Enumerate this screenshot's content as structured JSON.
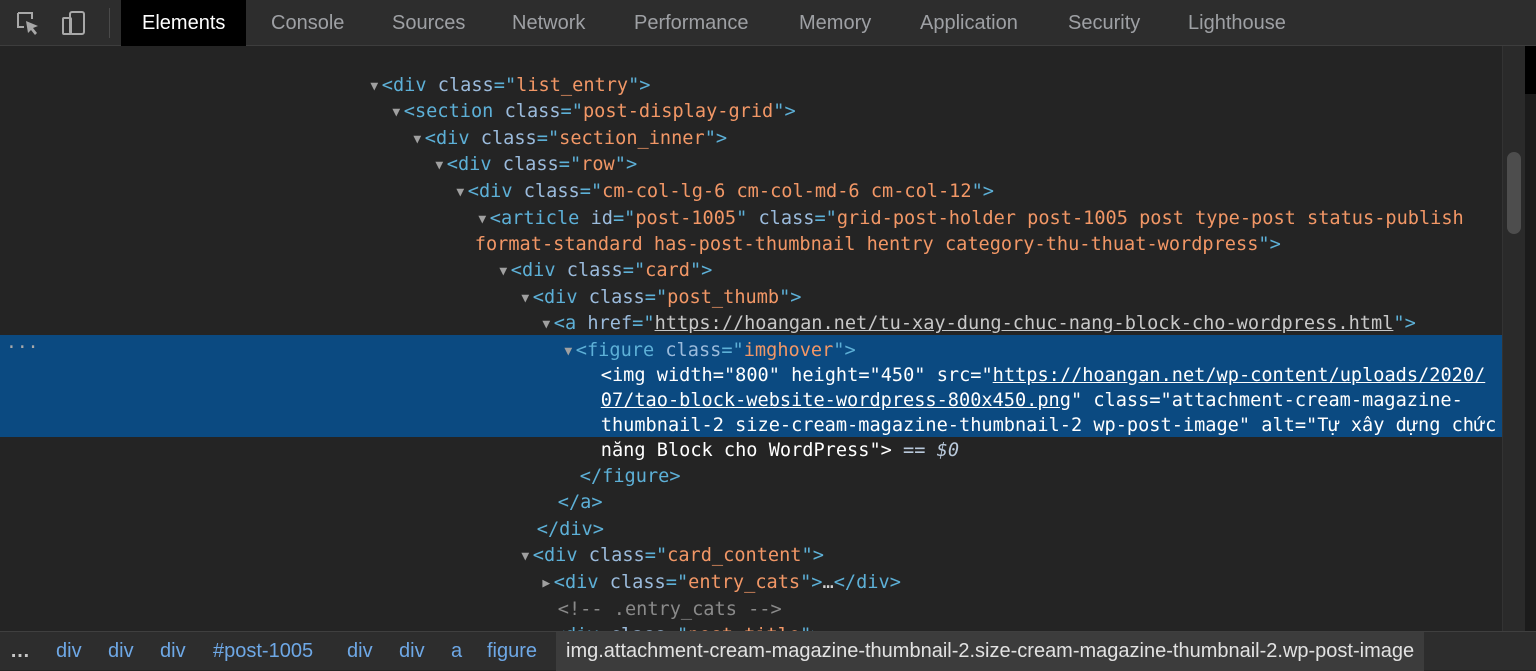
{
  "toolbar": {
    "inspect_icon": "inspect-element-icon",
    "device_icon": "device-toolbar-icon",
    "tabs": [
      {
        "label": "Elements",
        "active": true
      },
      {
        "label": "Console"
      },
      {
        "label": "Sources"
      },
      {
        "label": "Network"
      },
      {
        "label": "Performance"
      },
      {
        "label": "Memory"
      },
      {
        "label": "Application"
      },
      {
        "label": "Security"
      },
      {
        "label": "Lighthouse"
      }
    ]
  },
  "dom": {
    "l1": {
      "tag": "div",
      "attr": "class",
      "val": "list_entry"
    },
    "l2": {
      "tag": "section",
      "attr": "class",
      "val": "post-display-grid"
    },
    "l3": {
      "tag": "div",
      "attr": "class",
      "val": "section_inner"
    },
    "l4": {
      "tag": "div",
      "attr": "class",
      "val": "row"
    },
    "l5": {
      "tag": "div",
      "attr": "class",
      "val": "cm-col-lg-6 cm-col-md-6 cm-col-12"
    },
    "l6": {
      "tag": "article",
      "attr_id": "id",
      "val_id": "post-1005",
      "attr_class": "class",
      "val_class_1": "grid-post-holder post-1005 post type-post status-publish",
      "val_class_2": "format-standard has-post-thumbnail hentry category-thu-thuat-wordpress"
    },
    "l7": {
      "tag": "div",
      "attr": "class",
      "val": "card"
    },
    "l8": {
      "tag": "div",
      "attr": "class",
      "val": "post_thumb"
    },
    "l9": {
      "tag": "a",
      "attr": "href",
      "val": "https://hoangan.net/tu-xay-dung-chuc-nang-block-cho-wordpress.html"
    },
    "l10": {
      "tag": "figure",
      "attr": "class",
      "val": "imghover"
    },
    "img": {
      "tag": "img",
      "width_attr": "width",
      "width": "800",
      "height_attr": "height",
      "height": "450",
      "src_attr": "src",
      "src_1": "https://hoangan.net/wp-content/uploads/2020/",
      "src_2": "07/tao-block-website-wordpress-800x450.png",
      "class_attr": "class",
      "class_1": "attachment-cream-magazine-",
      "class_2": "thumbnail-2 size-cream-magazine-thumbnail-2 wp-post-image",
      "alt_attr": "alt",
      "alt_1": "Tự xây dựng chức",
      "alt_2": "năng Block cho WordPress",
      "eq": "==",
      "ref": "$0"
    },
    "close_figure": "figure",
    "close_a": "a",
    "close_div": "div",
    "l14": {
      "tag": "div",
      "attr": "class",
      "val": "card_content"
    },
    "l15": {
      "tag": "div",
      "attr": "class",
      "val": "entry_cats",
      "ellipsis": "…",
      "close": "div"
    },
    "comment": "<!-- .entry_cats -->",
    "l17": {
      "tag": "div",
      "attr": "class",
      "val": "post_title"
    },
    "row_ellipsis": "…"
  },
  "breadcrumb": {
    "dots": "…",
    "items": [
      "div",
      "div",
      "div",
      "#post-1005",
      "div",
      "div",
      "a",
      "figure"
    ],
    "current": "img.attachment-cream-magazine-thumbnail-2.size-cream-magazine-thumbnail-2.wp-post-image"
  }
}
